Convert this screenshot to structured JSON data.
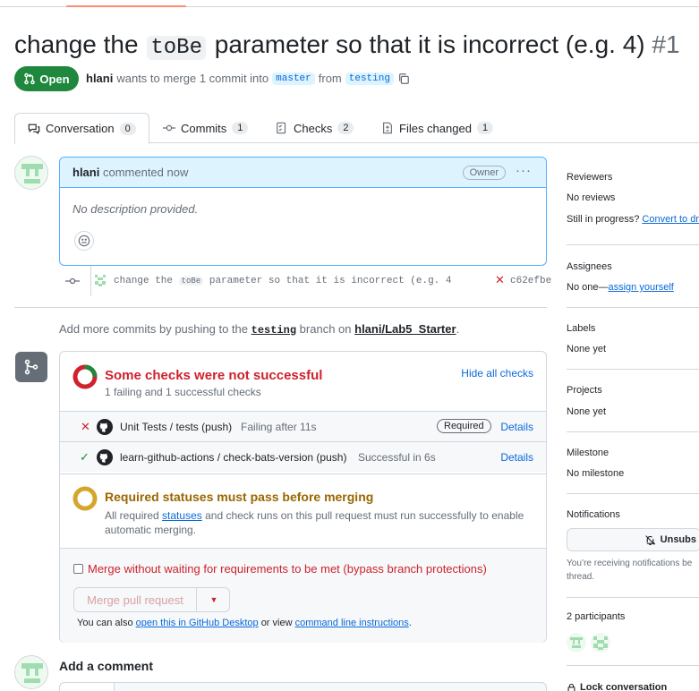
{
  "pr": {
    "title_pre": "change the",
    "title_code": "toBe",
    "title_post": "parameter so that it is incorrect (e.g. 4)",
    "number": "#1",
    "state": "Open",
    "author": "hlani",
    "merge_text": "wants to merge 1 commit into",
    "base": "master",
    "from": "from",
    "head": "testing"
  },
  "tabs": [
    {
      "label": "Conversation",
      "count": "0"
    },
    {
      "label": "Commits",
      "count": "1"
    },
    {
      "label": "Checks",
      "count": "2"
    },
    {
      "label": "Files changed",
      "count": "1"
    }
  ],
  "comment": {
    "author": "hlani",
    "action": "commented now",
    "role": "Owner",
    "body": "No description provided."
  },
  "commit": {
    "message_pre": "change the",
    "message_code": "toBe",
    "message_post": "parameter so that it is incorrect (e.g. 4",
    "sha": "c62efbe"
  },
  "hint": {
    "pre": "Add more commits by pushing to the",
    "branch": "testing",
    "mid": "branch on",
    "repo": "hlani/Lab5_Starter",
    "end": "."
  },
  "checks": {
    "title": "Some checks were not successful",
    "subtitle": "1 failing and 1 successful checks",
    "hide": "Hide all checks",
    "items": [
      {
        "name": "Unit Tests / tests (push)",
        "status": "Failing after 11s",
        "required": "Required",
        "details": "Details"
      },
      {
        "name": "learn-github-actions / check-bats-version (push)",
        "status": "Successful in 6s",
        "details": "Details"
      }
    ]
  },
  "required": {
    "title": "Required statuses must pass before merging",
    "text_pre": "All required",
    "link": "statuses",
    "text_post": "and check runs on this pull request must run successfully to enable",
    "text_line2": "automatic merging."
  },
  "merge": {
    "bypass": "Merge without waiting for requirements to be met (bypass branch protections)",
    "button": "Merge pull request",
    "also_pre": "You can also",
    "desktop": "open this in GitHub Desktop",
    "also_mid": "or view",
    "cli": "command line instructions",
    "also_end": "."
  },
  "add_comment": "Add a comment",
  "sidebar": {
    "reviewers": "Reviewers",
    "no_reviews": "No reviews",
    "in_progress": "Still in progress?",
    "convert": "Convert to dra",
    "assignees": "Assignees",
    "no_one": "No one—",
    "assign": "assign yourself",
    "labels": "Labels",
    "none_yet": "None yet",
    "projects": "Projects",
    "projects_val": "None yet",
    "milestone": "Milestone",
    "no_milestone": "No milestone",
    "notifications": "Notifications",
    "unsub": "Unsubs",
    "notif_text1": "You’re receiving notifications be",
    "notif_text2": "thread.",
    "participants": "2 participants",
    "lock": "Lock conversation"
  },
  "colors": {
    "green": "#1f883d",
    "red": "#cf222e",
    "accent": "#0969da",
    "warn": "#9a6700"
  }
}
